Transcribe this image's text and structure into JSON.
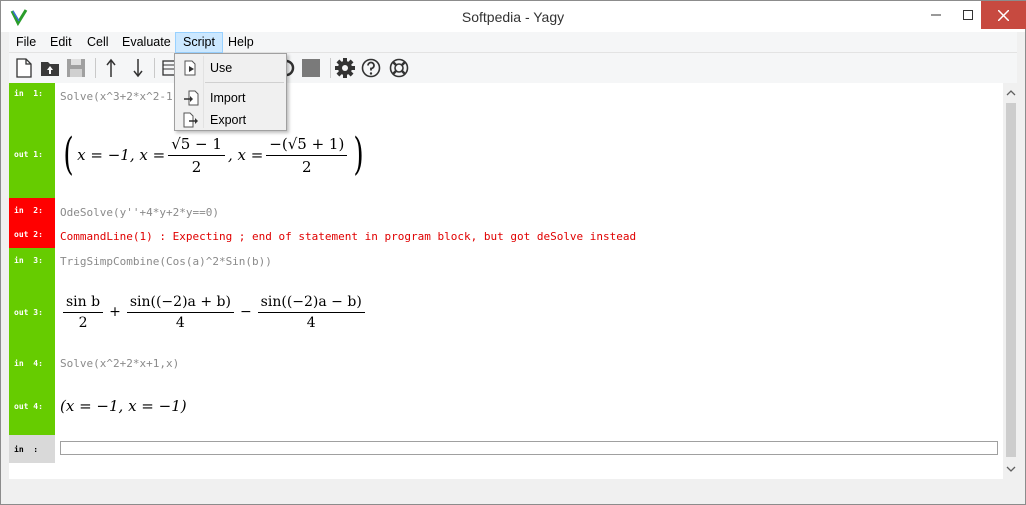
{
  "window": {
    "title": "Softpedia - Yagy",
    "colors": {
      "close_button": "#c74a40",
      "in_green": "#66cc00",
      "error_red": "#ff0000"
    }
  },
  "menu": {
    "items": [
      "File",
      "Edit",
      "Cell",
      "Evaluate",
      "Script",
      "Help"
    ],
    "active": "Script"
  },
  "toolbar": {
    "icons": [
      "new-file-icon",
      "open-file-icon",
      "save-icon",
      "move-up-icon",
      "move-down-icon",
      "table-icon",
      "refresh-icon",
      "stop-icon",
      "settings-icon",
      "help-icon",
      "lifebuoy-icon"
    ]
  },
  "script_menu": {
    "items": [
      {
        "label": "Use",
        "icon": "use-script-icon"
      },
      {
        "label": "Import",
        "icon": "import-icon"
      },
      {
        "label": "Export",
        "icon": "export-icon"
      }
    ]
  },
  "cells": {
    "in1": {
      "label": "in  1:",
      "code": "Solve(x^3+2*x^2-1"
    },
    "out1": {
      "label": "out 1:",
      "eq1": "x = −1, x =",
      "f1_num_rest": "5 − 1",
      "f1_den": "2",
      "sep": ", x =",
      "f2_num": "−(√5 + 1)",
      "f2_den": "2",
      "sqrt": "√"
    },
    "in2": {
      "label": "in  2:",
      "code": "OdeSolve(y''+4*y+2*y==0)"
    },
    "out2": {
      "label": "out 2:",
      "error": "CommandLine(1) : Expecting ; end of statement in program block, but got deSolve instead"
    },
    "in3": {
      "label": "in  3:",
      "code": "TrigSimpCombine(Cos(a)^2*Sin(b))"
    },
    "out3": {
      "label": "out 3:",
      "f1_num": "sin b",
      "f1_den": "2",
      "plus": "+",
      "f2_num": "sin((−2)a + b)",
      "f2_den": "4",
      "minus": "−",
      "f3_num": "sin((−2)a − b)",
      "f3_den": "4"
    },
    "in4": {
      "label": "in  4:",
      "code": "Solve(x^2+2*x+1,x)"
    },
    "out4": {
      "label": "out 4:",
      "result": "(x = −1, x = −1)"
    },
    "in5": {
      "label": "in  :",
      "value": ""
    }
  }
}
